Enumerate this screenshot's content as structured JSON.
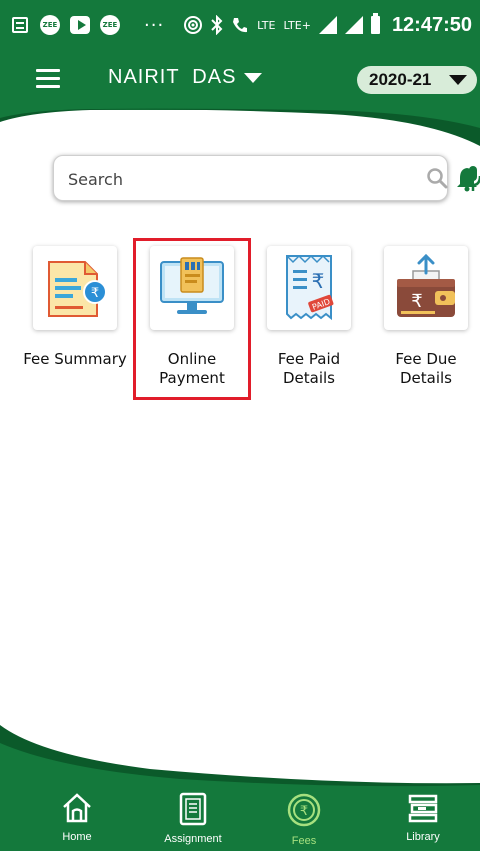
{
  "status_bar": {
    "time": "12:47:50",
    "badge_1": "ZEE",
    "badge_2": "ZEE",
    "overflow": "···",
    "network_1": "LTE",
    "network_2": "LTE+"
  },
  "header": {
    "user_name": "NAIRIT  DAS",
    "academic_year": "2020-21"
  },
  "search": {
    "placeholder": "Search"
  },
  "tiles": [
    {
      "label": "Fee Summary",
      "icon": "fee-summary-icon"
    },
    {
      "label": "Online Payment",
      "icon": "online-payment-icon"
    },
    {
      "label": "Fee Paid Details",
      "icon": "fee-paid-icon"
    },
    {
      "label": "Fee Due Details",
      "icon": "fee-due-icon"
    }
  ],
  "tile_lines": {
    "fee_summary": [
      "Fee Summary"
    ],
    "online_payment": [
      "Online",
      "Payment"
    ],
    "fee_paid": [
      "Fee Paid",
      "Details"
    ],
    "fee_due": [
      "Fee Due",
      "Details"
    ]
  },
  "bottom_nav": [
    {
      "label": "Home",
      "icon": "home-icon"
    },
    {
      "label": "Assignment",
      "icon": "assignment-icon"
    },
    {
      "label": "Fees",
      "icon": "fees-icon",
      "active": true
    },
    {
      "label": "Library",
      "icon": "library-icon"
    }
  ],
  "colors": {
    "brand_green": "#14793c",
    "dark_green": "#0b5a2a",
    "highlight_red": "#e11d2a",
    "active_nav": "#a6e07f"
  }
}
